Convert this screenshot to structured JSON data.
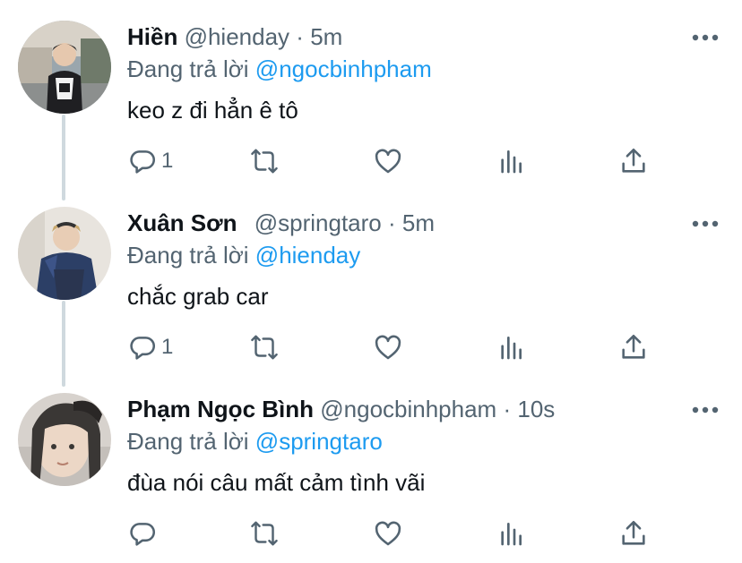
{
  "replies": [
    {
      "name": "Hiền",
      "handle": "@hienday",
      "separator": "·",
      "time": "5m",
      "reply_prefix": "Đang trả lời",
      "reply_to": "@ngocbinhpham",
      "text": "keo z đi hẳn ê tô",
      "reply_count": "1"
    },
    {
      "name": "Xuân Sơn",
      "handle": "@springtaro",
      "separator": "·",
      "time": "5m",
      "reply_prefix": "Đang trả lời",
      "reply_to": "@hienday",
      "text": "chắc grab car",
      "reply_count": "1"
    },
    {
      "name": "Phạm Ngọc Bình",
      "handle": "@ngocbinhpham",
      "separator": "·",
      "time": "10s",
      "reply_prefix": "Đang trả lời",
      "reply_to": "@springtaro",
      "text": "đùa nói câu mất cảm tình vãi",
      "reply_count": ""
    }
  ],
  "colors": {
    "text_primary": "#0f1419",
    "text_secondary": "#536471",
    "mention": "#1d9bf0",
    "thread_line": "#cfd9de"
  }
}
